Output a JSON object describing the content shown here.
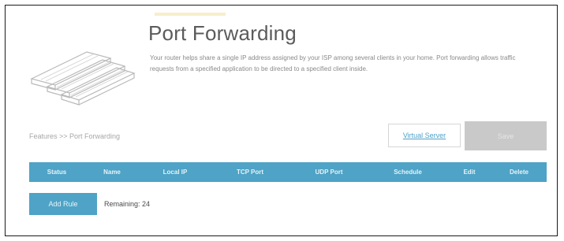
{
  "header": {
    "title": "Port Forwarding",
    "description": "Your router helps share a single IP address assigned by your ISP among several clients in your home. Port forwarding allows traffic requests from a specified application to be directed to a specified client inside."
  },
  "toolbar": {
    "breadcrumb": "Features >> Port Forwarding",
    "virtual_server_label": "Virtual Server",
    "save_label": "Save"
  },
  "rules_table": {
    "columns": [
      "Status",
      "Name",
      "Local IP",
      "TCP Port",
      "UDP Port",
      "Schedule",
      "Edit",
      "Delete"
    ]
  },
  "footer": {
    "add_rule_label": "Add Rule",
    "remaining_text": "Remaining: 24"
  },
  "colors": {
    "accent": "#4ea3c6",
    "save_disabled": "#c9c9c9",
    "link": "#4ca1c8"
  },
  "icons": {
    "hero": "port-forwarding-illustration-icon"
  }
}
